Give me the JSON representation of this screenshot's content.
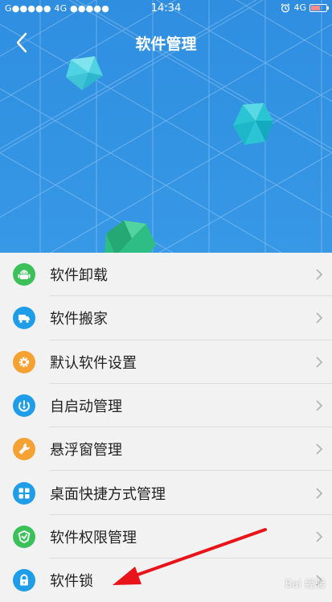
{
  "status_bar": {
    "carrier_left": "G●●●●● 4G ●●●●●",
    "time": "14:34",
    "network": "4G"
  },
  "header": {
    "title": "软件管理",
    "back_icon": "chevron-left-icon",
    "colors": {
      "background": "#3495e3"
    }
  },
  "menu": [
    {
      "label": "软件卸载",
      "icon": "android-icon",
      "color": "#3cc05a"
    },
    {
      "label": "软件搬家",
      "icon": "truck-icon",
      "color": "#1f9de8"
    },
    {
      "label": "默认软件设置",
      "icon": "gear-icon",
      "color": "#f5a233"
    },
    {
      "label": "自启动管理",
      "icon": "power-icon",
      "color": "#1f9de8"
    },
    {
      "label": "悬浮窗管理",
      "icon": "wrench-icon",
      "color": "#f5a233"
    },
    {
      "label": "桌面快捷方式管理",
      "icon": "grid-icon",
      "color": "#1f9de8"
    },
    {
      "label": "软件权限管理",
      "icon": "shield-icon",
      "color": "#3cc05a"
    },
    {
      "label": "软件锁",
      "icon": "lock-icon",
      "color": "#1f9de8"
    }
  ],
  "watermark": "Bai 经验"
}
